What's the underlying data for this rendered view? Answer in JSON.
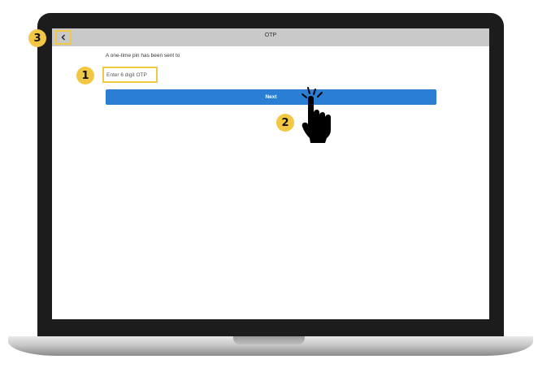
{
  "header": {
    "title": "OTP",
    "back_icon": "chevron-left-icon"
  },
  "main": {
    "message": "A one-time pin has been sent to",
    "otp_input": {
      "placeholder": "Enter 6 digit OTP",
      "value": ""
    },
    "next_button_label": "Next"
  },
  "markers": {
    "step1": "1",
    "step2": "2",
    "step3": "3"
  },
  "colors": {
    "highlight": "#f2c744",
    "primary_button": "#2a7fd4",
    "header_bg": "#c9c9c9"
  },
  "icons": {
    "pointer": "pointing-hand-icon"
  }
}
